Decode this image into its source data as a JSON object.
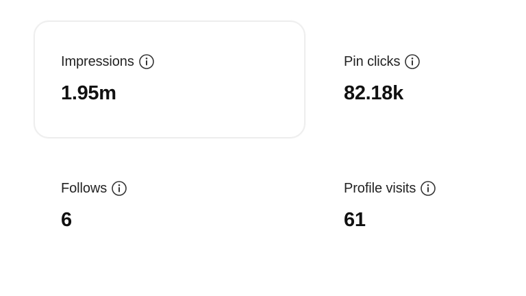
{
  "metrics": [
    {
      "label": "Impressions",
      "value": "1.95m",
      "selected": true,
      "icon": "info-icon"
    },
    {
      "label": "Pin clicks",
      "value": "82.18k",
      "selected": false,
      "icon": "info-icon"
    },
    {
      "label": "Follows",
      "value": "6",
      "selected": false,
      "icon": "info-icon"
    },
    {
      "label": "Profile visits",
      "value": "61",
      "selected": false,
      "icon": "info-icon"
    }
  ],
  "colors": {
    "text": "#111111",
    "card_border": "#eeeeee",
    "icon_stroke": "#333333"
  }
}
